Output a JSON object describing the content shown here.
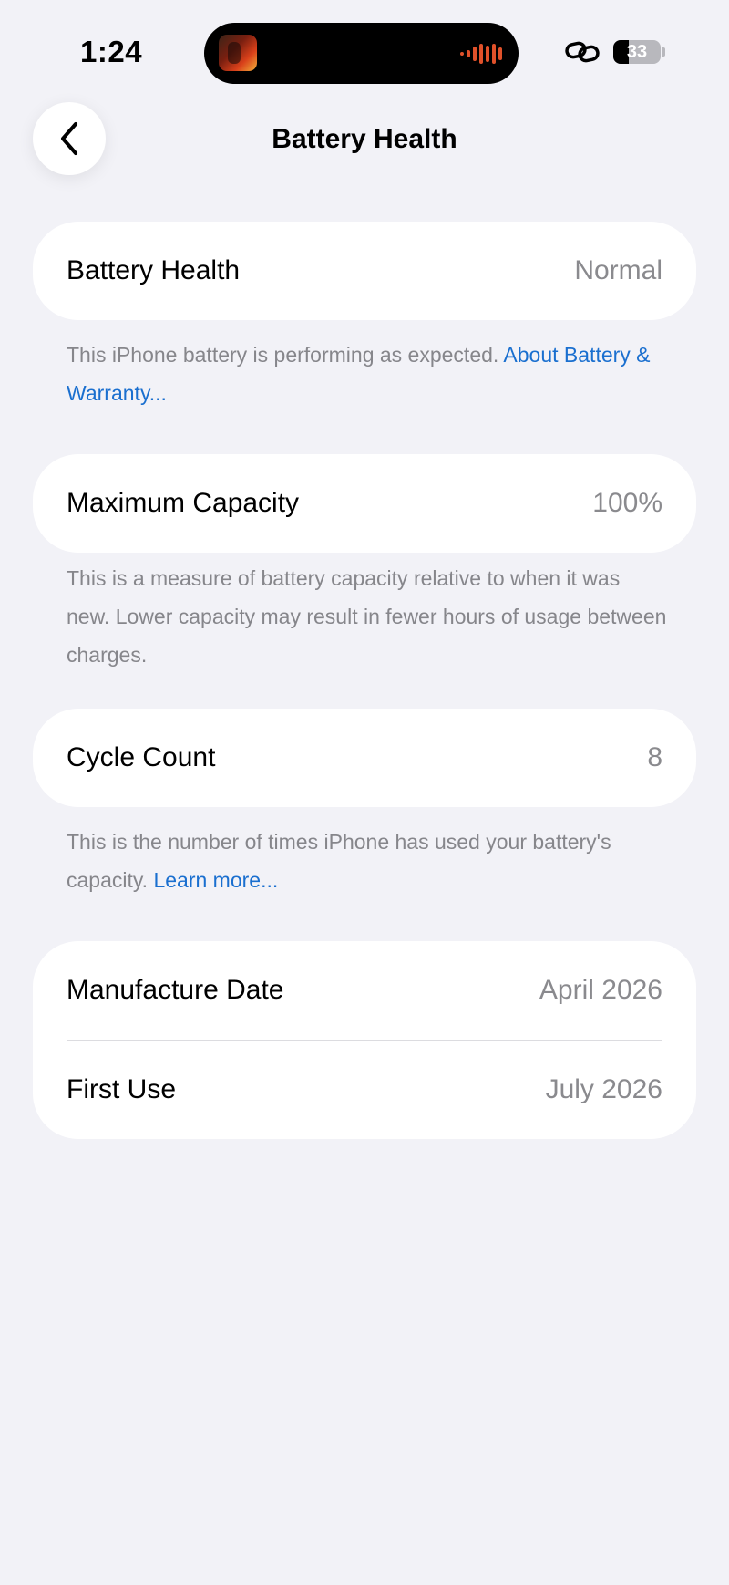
{
  "status_bar": {
    "time": "1:24",
    "battery_percent": "33",
    "battery_level": 0.33,
    "link_icon": "link-icon"
  },
  "nav": {
    "back_icon": "chevron-left-icon",
    "title": "Battery Health"
  },
  "battery_health": {
    "label": "Battery Health",
    "value": "Normal",
    "note_text": "This iPhone battery is performing as expected.",
    "note_link": "About Battery & Warranty..."
  },
  "maximum_capacity": {
    "label": "Maximum Capacity",
    "value": "100%",
    "note_text": "This is a measure of battery capacity relative to when it was new. Lower capacity may result in fewer hours of usage between charges."
  },
  "cycle_count": {
    "label": "Cycle Count",
    "value": "8",
    "note_text": "This is the number of times iPhone has used your battery's capacity.",
    "note_link": "Learn more..."
  },
  "dates": {
    "manufacture_label": "Manufacture Date",
    "manufacture_value": "April 2026",
    "first_use_label": "First Use",
    "first_use_value": "July 2026"
  },
  "colors": {
    "background": "#f2f2f7",
    "card": "#ffffff",
    "secondary_text": "#8a8a8e",
    "link": "#1a6fcf"
  }
}
